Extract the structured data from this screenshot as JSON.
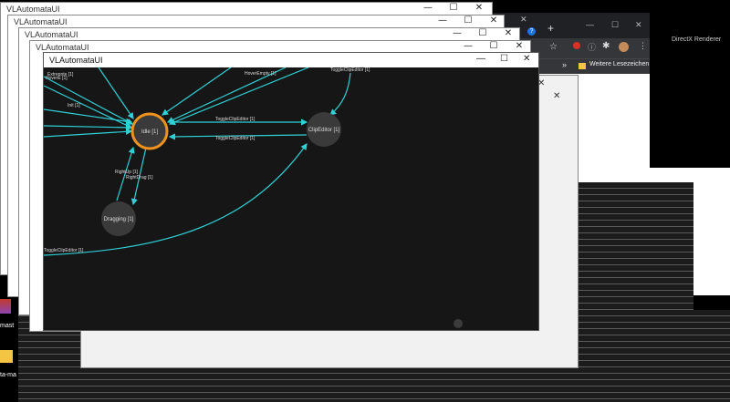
{
  "background_windows": [
    {
      "title": "VLAutomataUI"
    },
    {
      "title": "VLAutomataUI"
    },
    {
      "title": "VLAutomataUI"
    },
    {
      "title": "VLAutomataUI"
    }
  ],
  "window_controls": {
    "minimize": "—",
    "maximize": "☐",
    "close": "✕"
  },
  "browser": {
    "bookmark_label": "Weitere Lesezeichen",
    "chevron": "»",
    "new_tab": "+",
    "tab_close": "✕",
    "minimize": "—",
    "maximize": "☐",
    "close": "✕"
  },
  "directx": {
    "title": "DirectX Renderer"
  },
  "desktop": {
    "icon_label_1": "mast",
    "icon_label_2": "ta-ma"
  },
  "main_window": {
    "title": "VLAutomataUI"
  },
  "graph": {
    "nodes": {
      "idle": "Idle [1]",
      "clip_editor": "ClipEditor [1]",
      "dragging": "Dragging [1]"
    },
    "edges": {
      "hover_top": "HoverEmpty [1]",
      "toggle_top_right": "ToggleClipEditor [1]",
      "extern_left": "Extrepnte [1]",
      "hover_left": "HoverE [1]",
      "init": "Init [1]",
      "toggle_to_clip": "ToggleClipEditor [1]",
      "toggle_from_clip": "ToggleClipEditor [1]",
      "right_up": "RightUp [1]",
      "right_drag": "RightDrag [1]",
      "toggle_bottom": "ToggleClipEditor [1]"
    }
  }
}
